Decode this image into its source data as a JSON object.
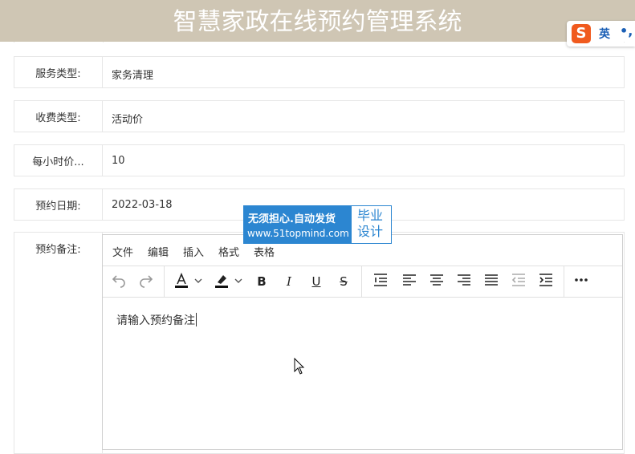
{
  "header": {
    "title": "智慧家政在线预约管理系统"
  },
  "ime": {
    "logo": "S",
    "mode": "英",
    "punct": "•,"
  },
  "form": {
    "service_type": {
      "label": "服务类型:",
      "value": "家务清理"
    },
    "fee_type": {
      "label": "收费类型:",
      "value": "活动价"
    },
    "hourly_price": {
      "label": "每小时价...",
      "value": "10"
    },
    "appointment_date": {
      "label": "预约日期:",
      "value": "2022-03-18"
    },
    "remarks": {
      "label": "预约备注:"
    }
  },
  "editor": {
    "menu": [
      "文件",
      "编辑",
      "插入",
      "格式",
      "表格"
    ],
    "content": "请输入预约备注"
  },
  "watermark": {
    "line1": "无须担心.自动发货",
    "line2": "www.51topmind.com",
    "right_line1": "毕业",
    "right_line2": "设计"
  },
  "colors": {
    "header": "#cfc6b4",
    "accent": "#2c86d1",
    "ime_logo": "#f05a1e"
  }
}
